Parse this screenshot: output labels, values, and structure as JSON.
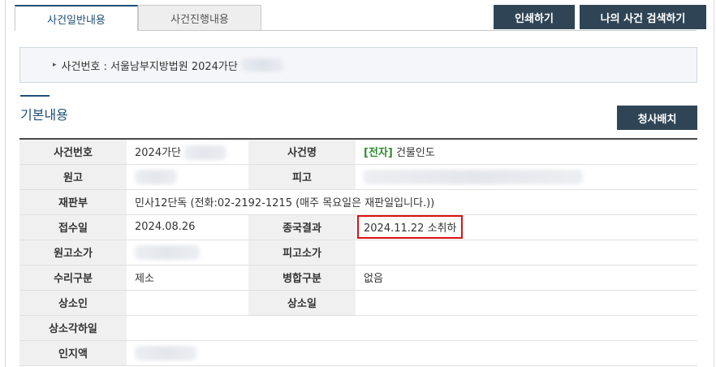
{
  "tabs": [
    {
      "label": "사건일반내용"
    },
    {
      "label": "사건진행내용"
    }
  ],
  "toolbar": {
    "print_label": "인쇄하기",
    "search_label": "나의 사건 검색하기"
  },
  "case_box": {
    "text": "사건번호 : 서울남부지방법원 2024가단"
  },
  "section": {
    "title": "기본내용",
    "assign_label": "청사배치"
  },
  "rows": [
    {
      "l1": "사건번호",
      "v1": "2024가단",
      "l2": "사건명",
      "v2_tag": "[전자]",
      "v2": " 건물인도"
    },
    {
      "l1": "원고",
      "v1": "",
      "l2": "피고",
      "v2": ""
    },
    {
      "l1": "재판부",
      "v1": "민사12단독 (전화:02-2192-1215 (매주 목요일은 재판일입니다.))"
    },
    {
      "l1": "접수일",
      "v1": "2024.08.26",
      "l2": "종국결과",
      "v2": "2024.11.22 소취하"
    },
    {
      "l1": "원고소가",
      "v1": "",
      "l2": "피고소가",
      "v2": ""
    },
    {
      "l1": "수리구분",
      "v1": "제소",
      "l2": "병합구분",
      "v2": "없음"
    },
    {
      "l1": "상소인",
      "v1": "",
      "l2": "상소일",
      "v2": ""
    },
    {
      "l1": "상소각하일",
      "v1": ""
    },
    {
      "l1": "인지액",
      "v1": ""
    }
  ]
}
